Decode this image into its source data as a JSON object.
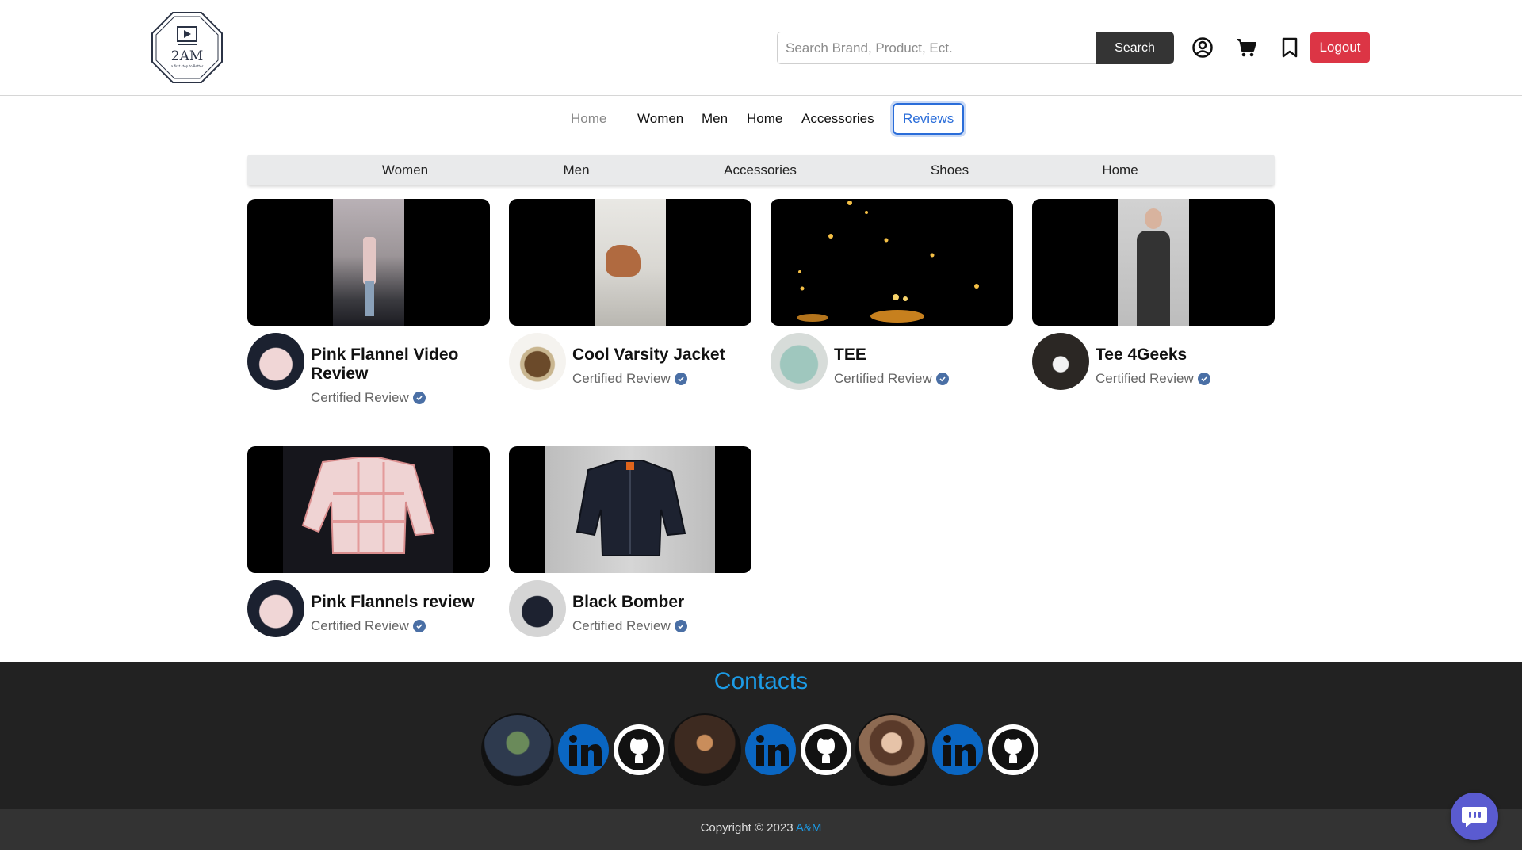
{
  "header": {
    "logo_text": "2AM",
    "logo_tagline": "a first step to Better",
    "search": {
      "placeholder": "Search Brand, Product, Ect.",
      "button_label": "Search"
    },
    "icons": [
      "user-circle-icon",
      "cart-icon",
      "bookmark-icon"
    ],
    "logout_label": "Logout"
  },
  "main_nav": {
    "items": [
      {
        "label": "Home"
      },
      {
        "label": "Women"
      },
      {
        "label": "Men"
      },
      {
        "label": "Home"
      },
      {
        "label": "Accessories"
      },
      {
        "label": "Reviews"
      }
    ]
  },
  "category_bar": {
    "items": [
      {
        "label": "Women"
      },
      {
        "label": "Men"
      },
      {
        "label": "Accessories"
      },
      {
        "label": "Shoes"
      },
      {
        "label": "Home"
      }
    ]
  },
  "reviews": [
    {
      "title": "Pink Flannel Video Review",
      "badge": "Certified Review"
    },
    {
      "title": "Cool Varsity Jacket",
      "badge": "Certified Review"
    },
    {
      "title": "TEE",
      "badge": "Certified Review"
    },
    {
      "title": "Tee 4Geeks",
      "badge": "Certified Review"
    },
    {
      "title": "Pink Flannels review",
      "badge": "Certified Review"
    },
    {
      "title": "Black Bomber",
      "badge": "Certified Review"
    }
  ],
  "footer": {
    "contacts_title": "Contacts",
    "contacts": [
      {
        "links": [
          "linkedin-icon",
          "github-icon"
        ]
      },
      {
        "links": [
          "linkedin-icon",
          "github-icon"
        ]
      },
      {
        "links": [
          "linkedin-icon",
          "github-icon"
        ]
      }
    ],
    "copyright_prefix": "Copyright © 2023",
    "copyright_brand": "A&M"
  },
  "colors": {
    "accent": "#2a6dd9",
    "logout": "#dc3545",
    "footer_bg": "#222222",
    "contacts_blue": "#1c9be6",
    "linkedin": "#0a66c2",
    "chat": "#5a5bd0"
  }
}
